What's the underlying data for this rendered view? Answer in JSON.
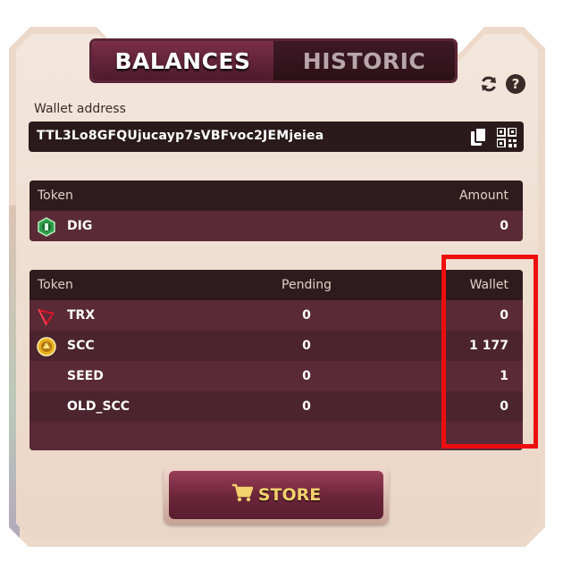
{
  "tabs": {
    "balances": "BALANCES",
    "historic": "HISTORIC"
  },
  "icons": {
    "refresh": "refresh-icon",
    "help": "help-icon",
    "copy": "copy-icon",
    "qr": "qr-code-icon",
    "cart": "cart-icon"
  },
  "wallet": {
    "label": "Wallet address",
    "address": "TTL3Lo8GFQUjucayp7sVBFvoc2JEMjeiea"
  },
  "game_tokens": {
    "headers": {
      "token": "Token",
      "amount": "Amount"
    },
    "rows": [
      {
        "token": "DIG",
        "amount": "0"
      }
    ]
  },
  "chain_tokens": {
    "headers": {
      "token": "Token",
      "pending": "Pending",
      "wallet": "Wallet"
    },
    "rows": [
      {
        "token": "TRX",
        "pending": "0",
        "wallet": "0"
      },
      {
        "token": "SCC",
        "pending": "0",
        "wallet": "1 177"
      },
      {
        "token": "SEED",
        "pending": "0",
        "wallet": "1"
      },
      {
        "token": "OLD_SCC",
        "pending": "0",
        "wallet": "0"
      }
    ]
  },
  "store": {
    "label": "STORE"
  },
  "colors": {
    "highlight": "#ee0e0e",
    "store_text": "#f3d16c",
    "panel": "#ecd9ca"
  }
}
